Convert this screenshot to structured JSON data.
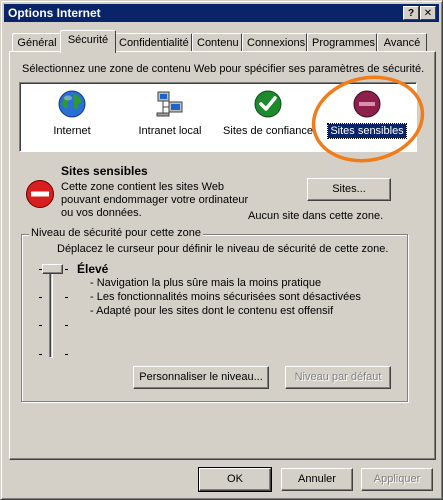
{
  "window": {
    "title": "Options Internet",
    "help_label": "?",
    "close_label": "✕"
  },
  "tabs": [
    {
      "label": "Général",
      "active": false
    },
    {
      "label": "Sécurité",
      "active": true
    },
    {
      "label": "Confidentialité",
      "active": false
    },
    {
      "label": "Contenu",
      "active": false
    },
    {
      "label": "Connexions",
      "active": false
    },
    {
      "label": "Programmes",
      "active": false
    },
    {
      "label": "Avancé",
      "active": false
    }
  ],
  "security": {
    "intro": "Sélectionnez une zone de contenu Web pour spécifier ses paramètres de sécurité.",
    "zones": [
      {
        "label": "Internet",
        "icon": "globe-icon",
        "selected": false
      },
      {
        "label": "Intranet local",
        "icon": "network-computers-icon",
        "selected": false
      },
      {
        "label": "Sites de confiance",
        "icon": "green-check-icon",
        "selected": false
      },
      {
        "label": "Sites sensibles",
        "icon": "restricted-icon",
        "selected": true
      }
    ],
    "zone_title": "Sites sensibles",
    "zone_desc_1": "Cette zone contient les sites Web",
    "zone_desc_2": "pouvant endommager votre ordinateur",
    "zone_desc_3": "ou vos données.",
    "sites_button": "Sites...",
    "no_sites_text": "Aucun site dans cette zone.",
    "level_group_label": "Niveau de sécurité pour cette zone",
    "level_instruction": "Déplacez le curseur pour définir le niveau de sécurité de cette zone.",
    "level_name": "Élevé",
    "level_points": [
      "- Navigation la plus sûre mais la moins pratique",
      "- Les fonctionnalités moins sécurisées sont désactivées",
      "- Adapté pour les sites dont le contenu est offensif"
    ],
    "slider_level": 4,
    "slider_max": 4,
    "custom_level_button": "Personnaliser le niveau...",
    "default_level_button": "Niveau par défaut"
  },
  "footer": {
    "ok": "OK",
    "cancel": "Annuler",
    "apply": "Appliquer"
  },
  "colors": {
    "titlebar": "#0a246a",
    "face": "#d4d0c8",
    "highlight_ring": "#f07d1a"
  }
}
